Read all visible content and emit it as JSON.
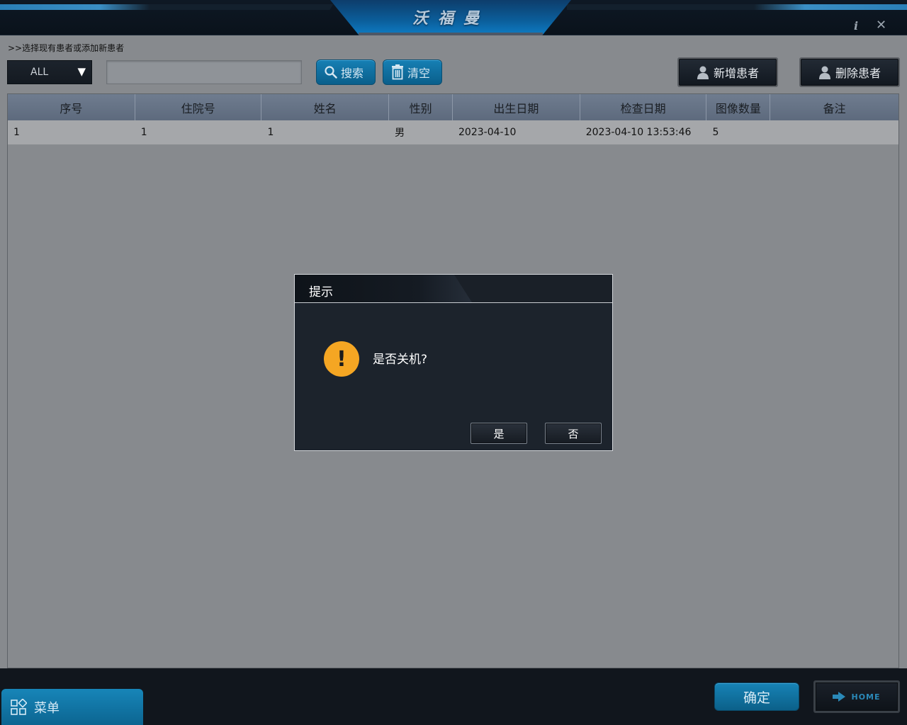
{
  "app": {
    "title": "沃福曼",
    "info_icon": "info-icon",
    "close_icon": "close-icon"
  },
  "toolbar": {
    "hint": ">>选择现有患者或添加新患者",
    "filter_value": "ALL",
    "search_value": "",
    "search_label": "搜索",
    "clear_label": "清空",
    "add_patient_label": "新增患者",
    "delete_patient_label": "删除患者"
  },
  "table": {
    "headers": [
      "序号",
      "住院号",
      "姓名",
      "性别",
      "出生日期",
      "检查日期",
      "图像数量",
      "备注"
    ],
    "rows": [
      [
        "1",
        "1",
        "1",
        "男",
        "2023-04-10",
        "2023-04-10 13:53:46",
        "5",
        ""
      ]
    ]
  },
  "dialog": {
    "title": "提示",
    "message": "是否关机?",
    "yes_label": "是",
    "no_label": "否",
    "icon": "warning-icon"
  },
  "footer": {
    "menu_label": "菜单",
    "confirm_label": "确定",
    "home_label": "HOME"
  },
  "colors": {
    "accent": "#0f75a8",
    "warning": "#f5a623",
    "dark": "#11161d"
  }
}
